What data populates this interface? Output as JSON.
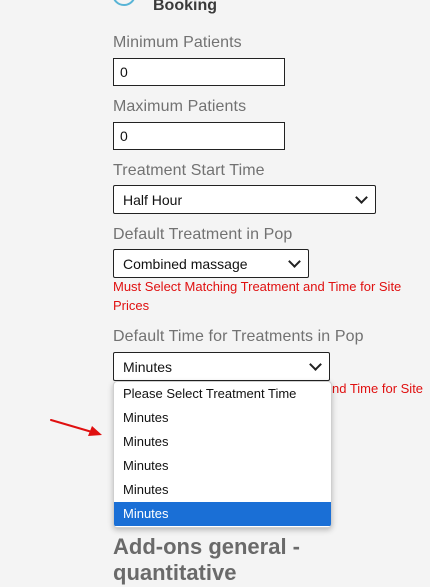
{
  "header": {
    "title": "Booking",
    "icon": "circle-icon"
  },
  "fields": {
    "min_patients": {
      "label": "Minimum Patients",
      "value": "0"
    },
    "max_patients": {
      "label": "Maximum Patients",
      "value": "0"
    },
    "treatment_start": {
      "label": "Treatment Start Time",
      "selected": "Half Hour"
    },
    "default_treatment": {
      "label": "Default Treatment in Pop",
      "selected": "Combined massage",
      "error_line1": "Must Select Matching Treatment and Time for Site",
      "error_line2": "Prices"
    },
    "default_time": {
      "label": "Default Time for Treatments in Pop",
      "selected": "Minutes",
      "error_partial": "nd Time for Site"
    }
  },
  "dropdown": {
    "options": [
      "Please Select Treatment Time",
      "Minutes",
      "Minutes",
      "Minutes",
      "Minutes",
      "Minutes"
    ],
    "selected_index": 5
  },
  "section": {
    "line1": "Add-ons general -",
    "line2": "quantitative"
  },
  "colors": {
    "error": "#e01010",
    "selected": "#1a6fd6",
    "arrow": "#e01010"
  }
}
